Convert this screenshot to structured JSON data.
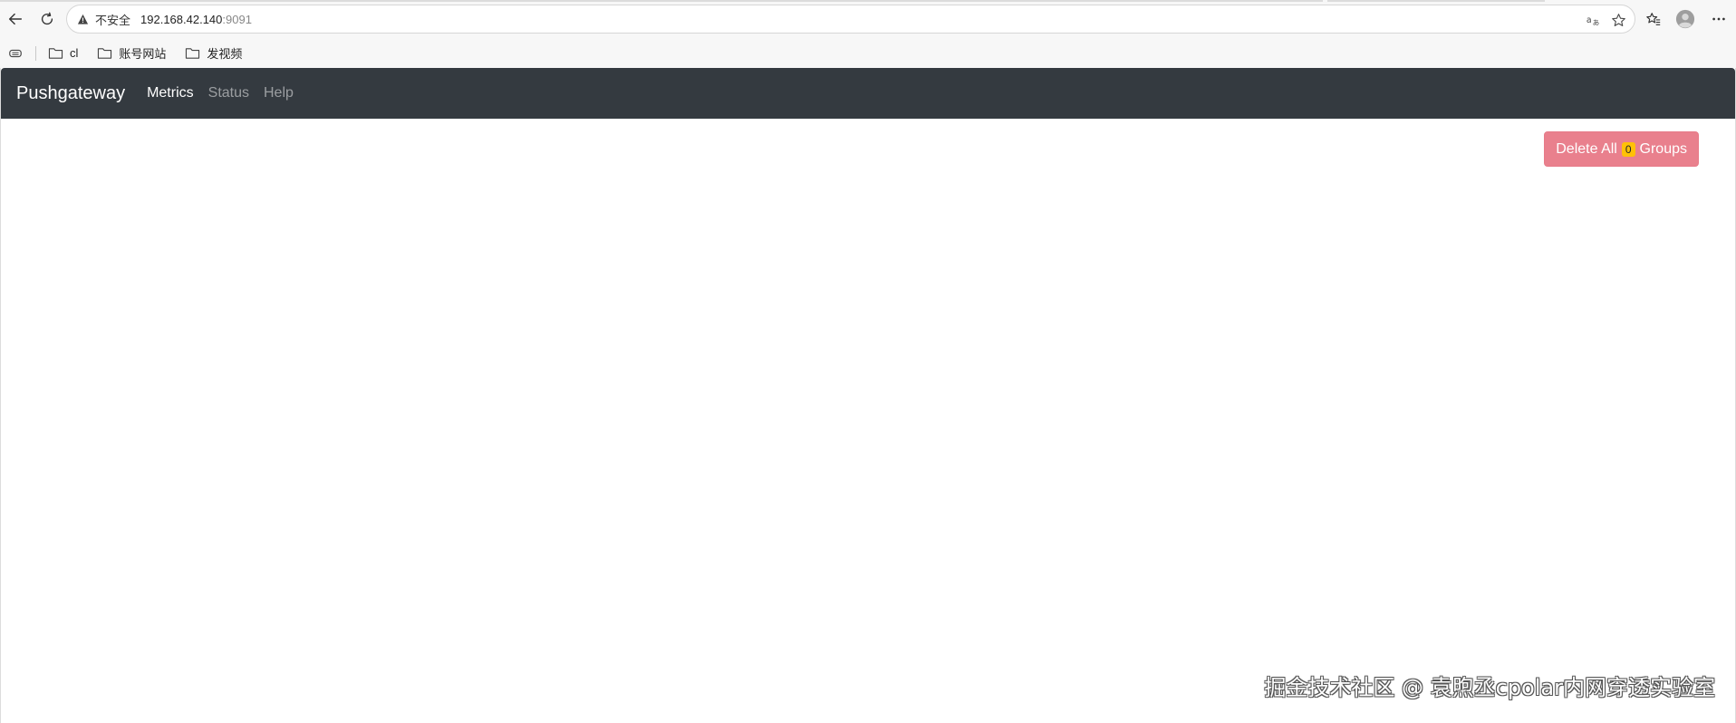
{
  "browser": {
    "insecure_label": "不安全",
    "url_host": "192.168.42.140",
    "url_port": ":9091"
  },
  "bookmarks": [
    {
      "label": "cl"
    },
    {
      "label": "账号网站"
    },
    {
      "label": "发视频"
    }
  ],
  "navbar": {
    "brand": "Pushgateway",
    "links": [
      {
        "label": "Metrics",
        "active": true
      },
      {
        "label": "Status",
        "active": false
      },
      {
        "label": "Help",
        "active": false
      }
    ]
  },
  "actions": {
    "delete_prefix": "Delete All",
    "group_count": "0",
    "delete_suffix": "Groups"
  },
  "watermark": "掘金技术社区 @ 袁煦丞cpolar内网穿透实验室"
}
